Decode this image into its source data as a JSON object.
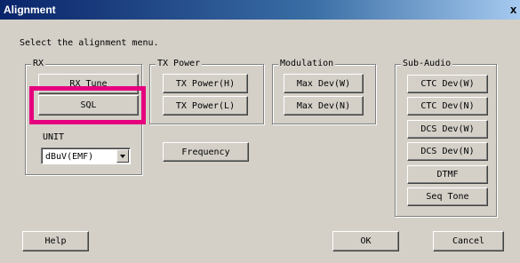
{
  "window": {
    "title": "Alignment",
    "close_glyph": "x"
  },
  "prompt": "Select the alignment menu.",
  "groups": {
    "rx": {
      "legend": "RX",
      "buttons": {
        "rx_tune": "RX Tune",
        "sql": "SQL"
      },
      "unit_label": "UNIT",
      "unit_select": {
        "value": "dBuV(EMF)"
      }
    },
    "tx_power": {
      "legend": "TX Power",
      "buttons": {
        "high": "TX Power(H)",
        "low": "TX Power(L)"
      }
    },
    "modulation": {
      "legend": "Modulation",
      "buttons": {
        "max_dev_w": "Max Dev(W)",
        "max_dev_n": "Max Dev(N)"
      }
    },
    "sub_audio": {
      "legend": "Sub-Audio",
      "buttons": {
        "ctc_w": "CTC Dev(W)",
        "ctc_n": "CTC Dev(N)",
        "dcs_w": "DCS Dev(W)",
        "dcs_n": "DCS Dev(N)",
        "dtmf": "DTMF",
        "seq_tone": "Seq Tone"
      }
    }
  },
  "frequency_button": "Frequency",
  "footer": {
    "help": "Help",
    "ok": "OK",
    "cancel": "Cancel"
  },
  "colors": {
    "highlight": "#e6007e",
    "titlebar": "#0a246a",
    "face": "#d4d0c8"
  }
}
